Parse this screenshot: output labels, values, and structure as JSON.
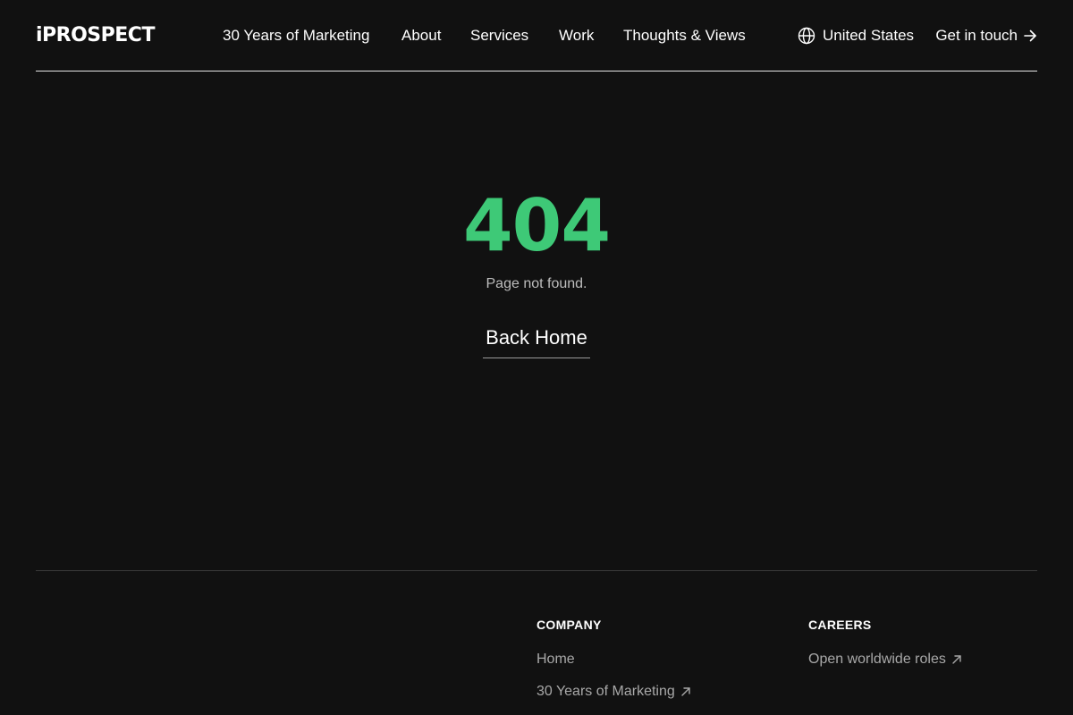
{
  "header": {
    "logo_text": "iPROSPECT",
    "nav": {
      "years": "30 Years of Marketing",
      "about": "About",
      "services": "Services",
      "work": "Work",
      "thoughts": "Thoughts & Views"
    },
    "region_label": "United States",
    "cta_label": "Get in touch"
  },
  "main": {
    "error_code": "404",
    "error_message": "Page not found.",
    "back_home_label": "Back Home"
  },
  "footer": {
    "company": {
      "heading": "COMPANY",
      "links": [
        "Home",
        "30 Years of Marketing"
      ]
    },
    "careers": {
      "heading": "CAREERS",
      "links": [
        "Open worldwide roles"
      ]
    }
  },
  "colors": {
    "background": "#111111",
    "accent_green": "#3ec977",
    "text_primary": "#ffffff",
    "text_muted": "#a8a8a8"
  },
  "icons": {
    "region": "globe-icon",
    "cta": "arrow-right-icon",
    "external_link": "arrow-up-right-icon"
  }
}
